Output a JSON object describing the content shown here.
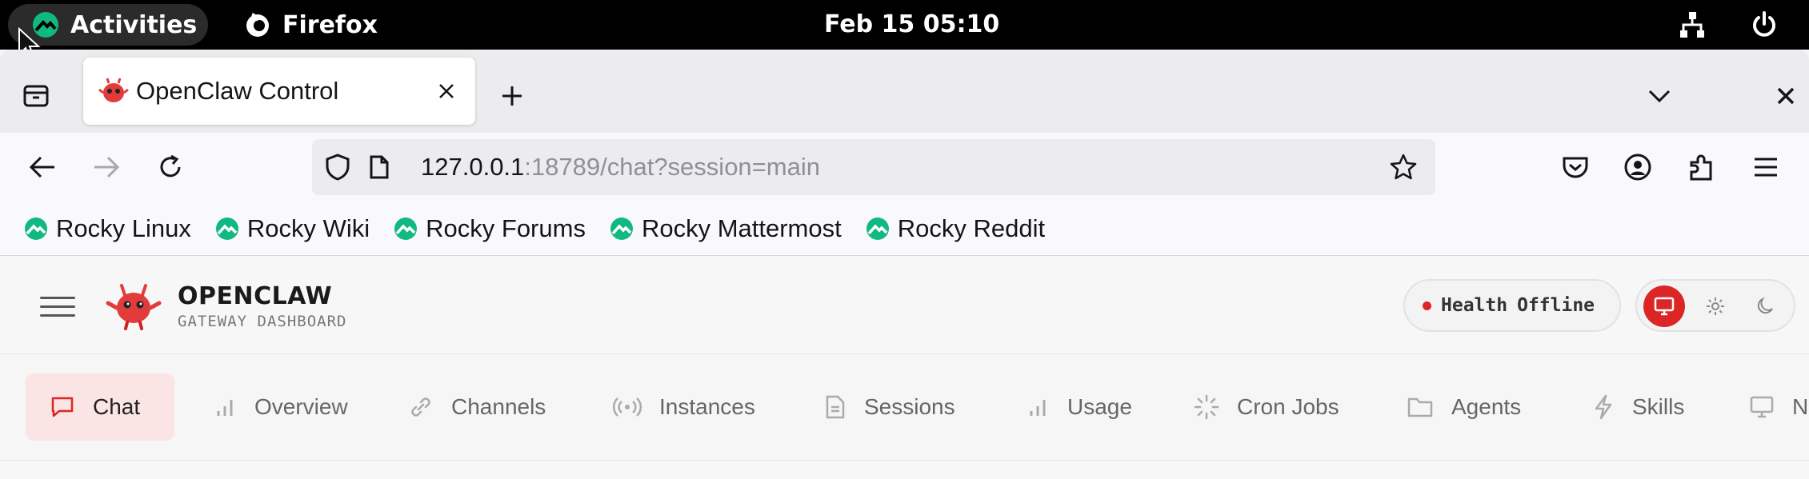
{
  "system_bar": {
    "activities_label": "Activities",
    "app_label": "Firefox",
    "clock": "Feb 15  05:10"
  },
  "browser": {
    "tab_title": "OpenClaw Control",
    "url_host": "127.0.0.1",
    "url_rest": ":18789/chat?session=main",
    "bookmarks": [
      {
        "label": "Rocky Linux"
      },
      {
        "label": "Rocky Wiki"
      },
      {
        "label": "Rocky Forums"
      },
      {
        "label": "Rocky Mattermost"
      },
      {
        "label": "Rocky Reddit"
      }
    ]
  },
  "app": {
    "brand_title": "OPENCLAW",
    "brand_subtitle": "GATEWAY DASHBOARD",
    "health_label": "Health",
    "health_status": "Offline",
    "accent_color": "#dc2626",
    "nav": [
      {
        "label": "Chat",
        "icon": "chat-bubble-icon",
        "active": true
      },
      {
        "label": "Overview",
        "icon": "bar-chart-icon"
      },
      {
        "label": "Channels",
        "icon": "link-icon"
      },
      {
        "label": "Instances",
        "icon": "radio-broadcast-icon"
      },
      {
        "label": "Sessions",
        "icon": "document-icon"
      },
      {
        "label": "Usage",
        "icon": "bar-chart-icon"
      },
      {
        "label": "Cron Jobs",
        "icon": "loader-icon"
      },
      {
        "label": "Agents",
        "icon": "folder-icon"
      },
      {
        "label": "Skills",
        "icon": "lightning-icon"
      },
      {
        "label": "N",
        "icon": "monitor-icon"
      }
    ]
  }
}
